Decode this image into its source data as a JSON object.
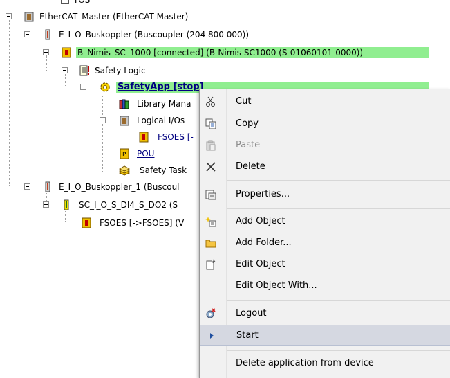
{
  "tree": {
    "root": "EtherCAT_Master (EtherCAT Master)",
    "coupler1": "E_I_O_Buskoppler (Buscoupler (204 800 000))",
    "nimis": "B_Nimis_SC_1000 [connected] (B-Nimis SC1000 (S-01060101-0000))",
    "safety_logic": "Safety Logic",
    "safety_app": "SafetyApp [stop]",
    "library": "Library Mana",
    "logical_ios": "Logical I/Os",
    "fsoes1": "FSOES [-",
    "pou": "POU",
    "safety_task": "Safety Task",
    "coupler2": "E_I_O_Buskoppler_1 (Buscoul",
    "sc_io": "SC_I_O_S_DI4_S_DO2 (S",
    "fsoes2": "FSOES [->FSOES]  (V",
    "top_partial": "TOS"
  },
  "context_menu": {
    "items": [
      {
        "label": "Cut",
        "icon": "scissors-icon",
        "disabled": false
      },
      {
        "label": "Copy",
        "icon": "copy-icon",
        "disabled": false
      },
      {
        "label": "Paste",
        "icon": "paste-icon",
        "disabled": true
      },
      {
        "label": "Delete",
        "icon": "delete-x-icon",
        "disabled": false
      },
      {
        "label": "Properties...",
        "icon": "properties-icon",
        "disabled": false
      },
      {
        "label": "Add Object",
        "icon": "add-object-icon",
        "disabled": false
      },
      {
        "label": "Add Folder...",
        "icon": "folder-icon",
        "disabled": false
      },
      {
        "label": "Edit Object",
        "icon": "edit-object-icon",
        "disabled": false
      },
      {
        "label": "Edit Object With...",
        "icon": "",
        "disabled": false
      },
      {
        "label": "Logout",
        "icon": "logout-icon",
        "disabled": false
      },
      {
        "label": "Start",
        "icon": "play-arrow-icon",
        "disabled": false,
        "hovered": true
      },
      {
        "label": "Delete application from device",
        "icon": "",
        "disabled": false
      }
    ]
  },
  "colors": {
    "highlight_green": "#90ee90",
    "menu_bg": "#f1f1f1",
    "menu_hover": "#d5d8e1"
  }
}
